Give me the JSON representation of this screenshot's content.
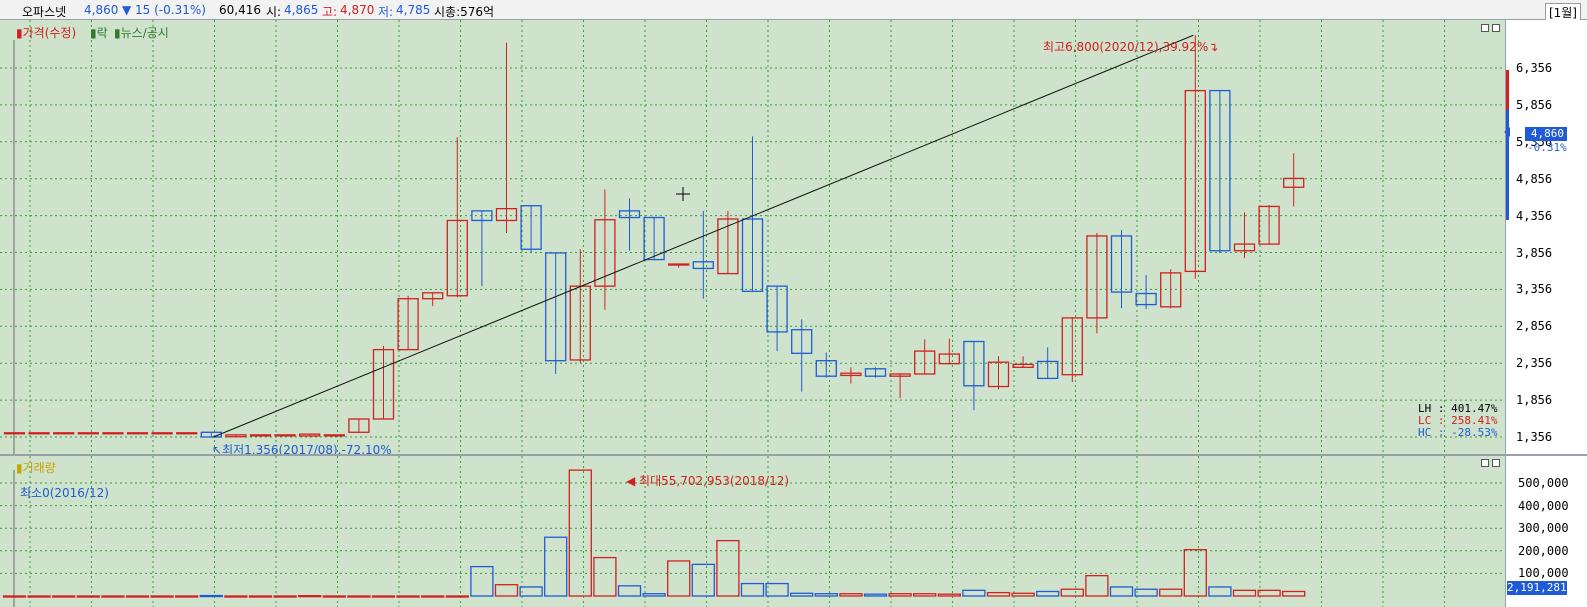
{
  "header": {
    "name": "오파스넷",
    "price": "4,860",
    "change": "▼ 15 (-0.31%)",
    "volume": "60,416",
    "open_label": "시:",
    "open": "4,865",
    "high_label": "고:",
    "high": "4,870",
    "low_label": "저:",
    "low": "4,785",
    "mcap": "시총:576억",
    "period": "[1월]"
  },
  "legend": {
    "price": "가격(수정)",
    "rak": "락",
    "news": "뉴스/공시",
    "volume": "거래량"
  },
  "annotations": {
    "max_price": "최고6,800(2020/12),39.92%",
    "min_price": "최저1,356(2017/08),-72.10%",
    "max_volume": "최대55,702,953(2018/12)",
    "min_volume": "최소0(2016/12)"
  },
  "stats": {
    "lh": "LH : 401.47%",
    "lc": "LC : 258.41%",
    "hc": "HC : -28.53%"
  },
  "price_tag": {
    "price": "4,860",
    "pct": "-0.31%"
  },
  "volume_tag": "2,191,281",
  "colors": {
    "up": "#d21f1f",
    "down": "#1f5bd6",
    "background": "#cfe3cc",
    "grid": "#3c9a3c"
  },
  "chart_data": [
    {
      "type": "candlestick",
      "title": "가격(수정)",
      "ylim": [
        1356,
        6800
      ],
      "y_ticks": [
        "6,356",
        "5,856",
        "5,356",
        "4,856",
        "4,356",
        "3,856",
        "3,356",
        "2,856",
        "2,356",
        "1,856",
        "1,356"
      ],
      "y_tick_values": [
        6356,
        5856,
        5356,
        4856,
        4356,
        3856,
        3356,
        2856,
        2356,
        1856,
        1356
      ],
      "candles": [
        {
          "o": 1413,
          "h": 1413,
          "l": 1413,
          "c": 1413
        },
        {
          "o": 1413,
          "h": 1413,
          "l": 1413,
          "c": 1413
        },
        {
          "o": 1413,
          "h": 1413,
          "l": 1413,
          "c": 1413
        },
        {
          "o": 1413,
          "h": 1413,
          "l": 1413,
          "c": 1413
        },
        {
          "o": 1413,
          "h": 1413,
          "l": 1413,
          "c": 1413
        },
        {
          "o": 1413,
          "h": 1413,
          "l": 1413,
          "c": 1413
        },
        {
          "o": 1413,
          "h": 1413,
          "l": 1413,
          "c": 1413
        },
        {
          "o": 1413,
          "h": 1413,
          "l": 1413,
          "c": 1413
        },
        {
          "o": 1420,
          "h": 1420,
          "l": 1356,
          "c": 1356
        },
        {
          "o": 1360,
          "h": 1385,
          "l": 1356,
          "c": 1385
        },
        {
          "o": 1385,
          "h": 1385,
          "l": 1385,
          "c": 1385
        },
        {
          "o": 1385,
          "h": 1385,
          "l": 1385,
          "c": 1385
        },
        {
          "o": 1370,
          "h": 1395,
          "l": 1370,
          "c": 1395
        },
        {
          "o": 1385,
          "h": 1385,
          "l": 1385,
          "c": 1385
        },
        {
          "o": 1420,
          "h": 1600,
          "l": 1420,
          "c": 1600
        },
        {
          "o": 1600,
          "h": 2590,
          "l": 1600,
          "c": 2540
        },
        {
          "o": 2540,
          "h": 3270,
          "l": 2540,
          "c": 3230
        },
        {
          "o": 3230,
          "h": 3310,
          "l": 3130,
          "c": 3310
        },
        {
          "o": 3270,
          "h": 5420,
          "l": 3250,
          "c": 4290
        },
        {
          "o": 4420,
          "h": 4420,
          "l": 3400,
          "c": 4290
        },
        {
          "o": 4290,
          "h": 6700,
          "l": 4120,
          "c": 4450
        },
        {
          "o": 4490,
          "h": 4490,
          "l": 3860,
          "c": 3900
        },
        {
          "o": 3850,
          "h": 3850,
          "l": 2210,
          "c": 2390
        },
        {
          "o": 2400,
          "h": 3900,
          "l": 2360,
          "c": 3400
        },
        {
          "o": 3400,
          "h": 4710,
          "l": 3080,
          "c": 4300
        },
        {
          "o": 4420,
          "h": 4590,
          "l": 3880,
          "c": 4330
        },
        {
          "o": 4330,
          "h": 4330,
          "l": 3750,
          "c": 3760
        },
        {
          "o": 3700,
          "h": 3700,
          "l": 3650,
          "c": 3700
        },
        {
          "o": 3730,
          "h": 4420,
          "l": 3230,
          "c": 3640
        },
        {
          "o": 3570,
          "h": 4420,
          "l": 3570,
          "c": 4310
        },
        {
          "o": 4310,
          "h": 5430,
          "l": 3340,
          "c": 3330
        },
        {
          "o": 3400,
          "h": 3400,
          "l": 2520,
          "c": 2780
        },
        {
          "o": 2810,
          "h": 2950,
          "l": 1970,
          "c": 2490
        },
        {
          "o": 2390,
          "h": 2500,
          "l": 2160,
          "c": 2180
        },
        {
          "o": 2190,
          "h": 2300,
          "l": 2080,
          "c": 2220
        },
        {
          "o": 2280,
          "h": 2300,
          "l": 2160,
          "c": 2180
        },
        {
          "o": 2180,
          "h": 2220,
          "l": 1880,
          "c": 2210
        },
        {
          "o": 2210,
          "h": 2680,
          "l": 2210,
          "c": 2520
        },
        {
          "o": 2350,
          "h": 2690,
          "l": 2340,
          "c": 2480
        },
        {
          "o": 2650,
          "h": 2650,
          "l": 1720,
          "c": 2050
        },
        {
          "o": 2040,
          "h": 2450,
          "l": 2000,
          "c": 2370
        },
        {
          "o": 2300,
          "h": 2450,
          "l": 2300,
          "c": 2340
        },
        {
          "o": 2380,
          "h": 2570,
          "l": 2150,
          "c": 2150
        },
        {
          "o": 2200,
          "h": 2980,
          "l": 2100,
          "c": 2970
        },
        {
          "o": 2970,
          "h": 4120,
          "l": 2760,
          "c": 4080
        },
        {
          "o": 4080,
          "h": 4160,
          "l": 3100,
          "c": 3320
        },
        {
          "o": 3300,
          "h": 3550,
          "l": 3090,
          "c": 3150
        },
        {
          "o": 3120,
          "h": 3630,
          "l": 3100,
          "c": 3580
        },
        {
          "o": 3600,
          "h": 6800,
          "l": 3500,
          "c": 6050
        },
        {
          "o": 6050,
          "h": 6050,
          "l": 3850,
          "c": 3880
        },
        {
          "o": 3880,
          "h": 4400,
          "l": 3780,
          "c": 3970
        },
        {
          "o": 3970,
          "h": 4500,
          "l": 3960,
          "c": 4480
        },
        {
          "o": 4740,
          "h": 5200,
          "l": 4480,
          "c": 4860
        }
      ]
    },
    {
      "type": "bar",
      "title": "거래량",
      "ylim": [
        0,
        600000
      ],
      "y_ticks": [
        "500,000",
        "400,000",
        "300,000",
        "200,000",
        "100,000"
      ],
      "y_tick_values": [
        500000,
        400000,
        300000,
        200000,
        100000
      ],
      "values": [
        0,
        0,
        0,
        0,
        0,
        0,
        0,
        0,
        2000,
        0,
        0,
        0,
        1500,
        0,
        0,
        0,
        0,
        0,
        0,
        130000,
        50000,
        40000,
        260000,
        557030,
        170000,
        45000,
        10000,
        155000,
        140000,
        245000,
        55000,
        55000,
        12000,
        10000,
        10000,
        8000,
        10000,
        10000,
        8000,
        25000,
        15000,
        12000,
        20000,
        30000,
        90000,
        40000,
        30000,
        30000,
        205000,
        40000,
        25000,
        25000,
        20000
      ]
    }
  ]
}
